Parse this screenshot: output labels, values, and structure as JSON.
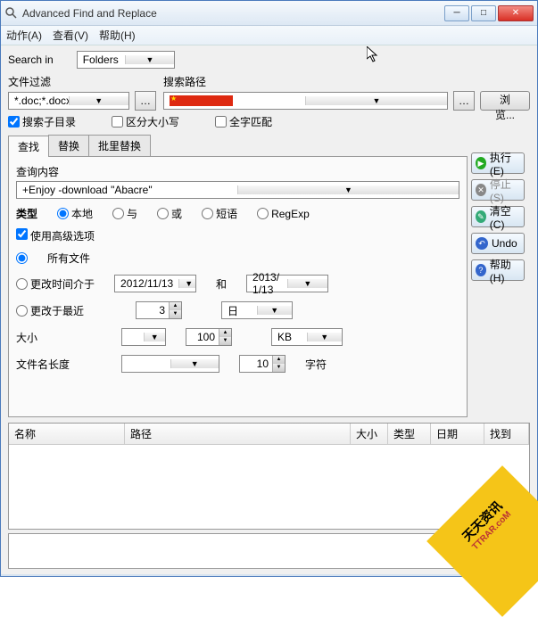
{
  "window": {
    "title": "Advanced Find and Replace"
  },
  "menu": {
    "action": "动作(A)",
    "view": "查看(V)",
    "help": "帮助(H)"
  },
  "search": {
    "searchin_label": "Search in",
    "searchin_value": "Folders",
    "filter_label": "文件过滤",
    "filter_value": "*.doc;*.docx;*.xls;*.xlsx;*.h",
    "path_label": "搜索路径",
    "path_value": "",
    "browse": "浏览...",
    "subfolders": "搜索子目录",
    "case": "区分大小写",
    "wholeword": "全字匹配"
  },
  "tabs": {
    "find": "查找",
    "replace": "替换",
    "batch": "批里替换"
  },
  "query": {
    "label": "查询内容",
    "value": "+Enjoy -download \"Abacre\"",
    "type_label": "类型",
    "r_local": "本地",
    "r_and": "与",
    "r_or": "或",
    "r_phrase": "短语",
    "r_regexp": "RegExp",
    "adv": "使用高级选项",
    "allfiles": "所有文件",
    "modbetween": "更改时间介于",
    "date1": "2012/11/13",
    "and": "和",
    "date2": "2013/ 1/13",
    "modrecent": "更改于最近",
    "recent_n": "3",
    "recent_unit": "日",
    "size_label": "大小",
    "size_op": "",
    "size_n": "100",
    "size_unit": "KB",
    "fname_label": "文件名长度",
    "fname_op": "",
    "fname_n": "10",
    "fname_unit": "字符"
  },
  "buttons": {
    "run": "执行(E)",
    "stop": "停止(S)",
    "clear": "清空(C)",
    "undo": "Undo",
    "help": "帮助(H)"
  },
  "results": {
    "name": "名称",
    "path": "路径",
    "size": "大小",
    "type": "类型",
    "date": "日期",
    "found": "找到"
  },
  "watermark": {
    "l1": "天天资讯",
    "l2": "TTRAR.coM"
  }
}
